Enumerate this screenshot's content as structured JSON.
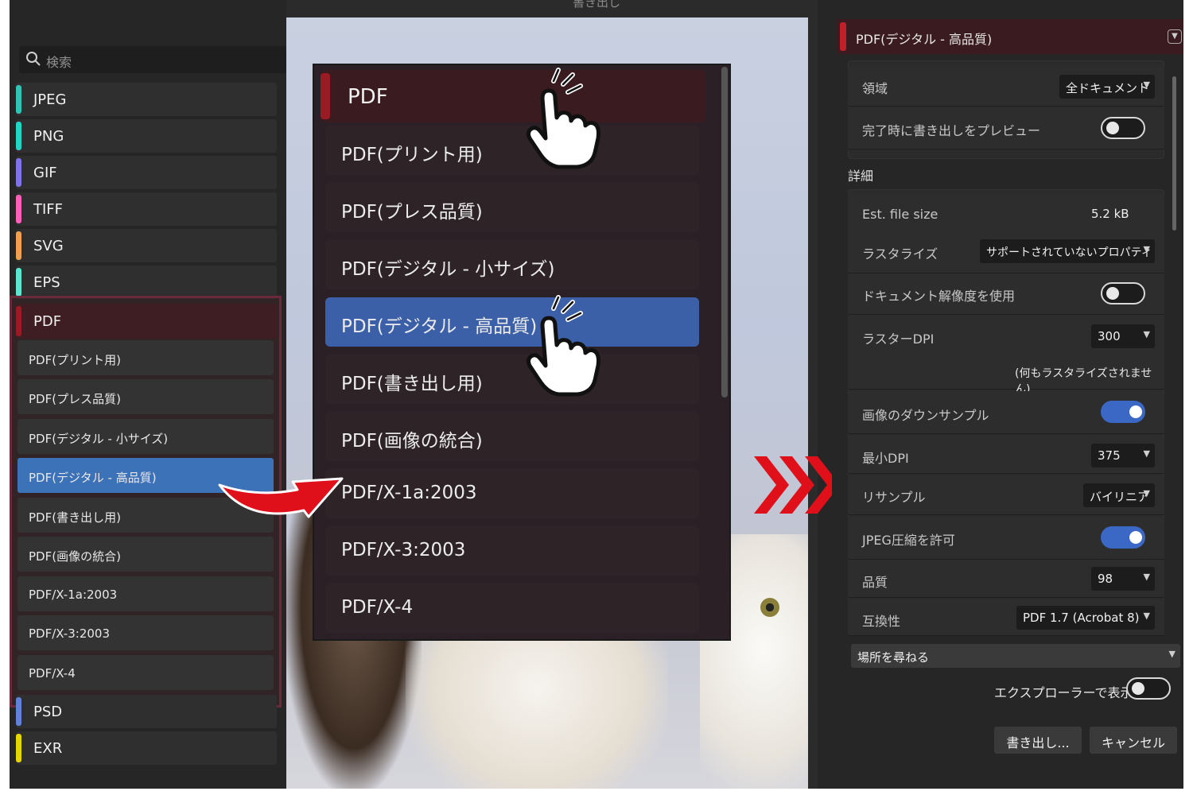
{
  "window": {
    "title": "書き出し",
    "close": "✕"
  },
  "search": {
    "placeholder": "検索"
  },
  "formats": [
    {
      "label": "JPEG",
      "color": "#2ec4b6"
    },
    {
      "label": "PNG",
      "color": "#23d4c9"
    },
    {
      "label": "GIF",
      "color": "#7f73e6"
    },
    {
      "label": "TIFF",
      "color": "#ff5fb8"
    },
    {
      "label": "SVG",
      "color": "#f0a050"
    },
    {
      "label": "EPS",
      "color": "#5ae6d0"
    }
  ],
  "pdf_group": {
    "label": "PDF",
    "color": "#9a1b23",
    "presets": [
      "PDF(プリント用)",
      "PDF(プレス品質)",
      "PDF(デジタル - 小サイズ)",
      "PDF(デジタル - 高品質)",
      "PDF(書き出し用)",
      "PDF(画像の統合)",
      "PDF/X-1a:2003",
      "PDF/X-3:2003",
      "PDF/X-4"
    ],
    "selected_index": 3
  },
  "formats_after": [
    {
      "label": "PSD",
      "color": "#5f84d6"
    },
    {
      "label": "EXR",
      "color": "#e8d400"
    }
  ],
  "zoom_menu": {
    "label": "PDF",
    "items": [
      "PDF(プリント用)",
      "PDF(プレス品質)",
      "PDF(デジタル - 小サイズ)",
      "PDF(デジタル - 高品質)",
      "PDF(書き出し用)",
      "PDF(画像の統合)",
      "PDF/X-1a:2003",
      "PDF/X-3:2003",
      "PDF/X-4"
    ],
    "selected_index": 3
  },
  "settings": {
    "header": "PDF(デジタル - 高品質)",
    "area": {
      "label": "領域",
      "value": "全ドキュメント"
    },
    "preview_on_finish": {
      "label": "完了時に書き出しをプレビュー",
      "on": false
    },
    "details_label": "詳細",
    "file_size": {
      "label": "Est. file size",
      "value": "5.2 kB"
    },
    "rasterize": {
      "label": "ラスタライズ",
      "value": "サポートされていないプロパティ"
    },
    "use_doc_dpi": {
      "label": "ドキュメント解像度を使用",
      "on": false
    },
    "raster_dpi": {
      "label": "ラスターDPI",
      "value": "300"
    },
    "raster_note": "(何もラスタライズされません)",
    "downsample": {
      "label": "画像のダウンサンプル",
      "on": true
    },
    "min_dpi": {
      "label": "最小DPI",
      "value": "375"
    },
    "resample": {
      "label": "リサンプル",
      "value": "バイリニア"
    },
    "jpeg_allow": {
      "label": "JPEG圧縮を許可",
      "on": true
    },
    "quality": {
      "label": "品質",
      "value": "98"
    },
    "compat": {
      "label": "互換性",
      "value": "PDF 1.7 (Acrobat 8)"
    },
    "location": {
      "value": "場所を尋ねる"
    },
    "show_explorer": {
      "label": "エクスプローラーで表示",
      "on": false
    },
    "export_btn": "書き出し...",
    "cancel_btn": "キャンセル"
  },
  "colors": {
    "accent_blue": "#3c60a8",
    "pdf_red": "#9a1b23",
    "arrow_red": "#e0101a"
  }
}
